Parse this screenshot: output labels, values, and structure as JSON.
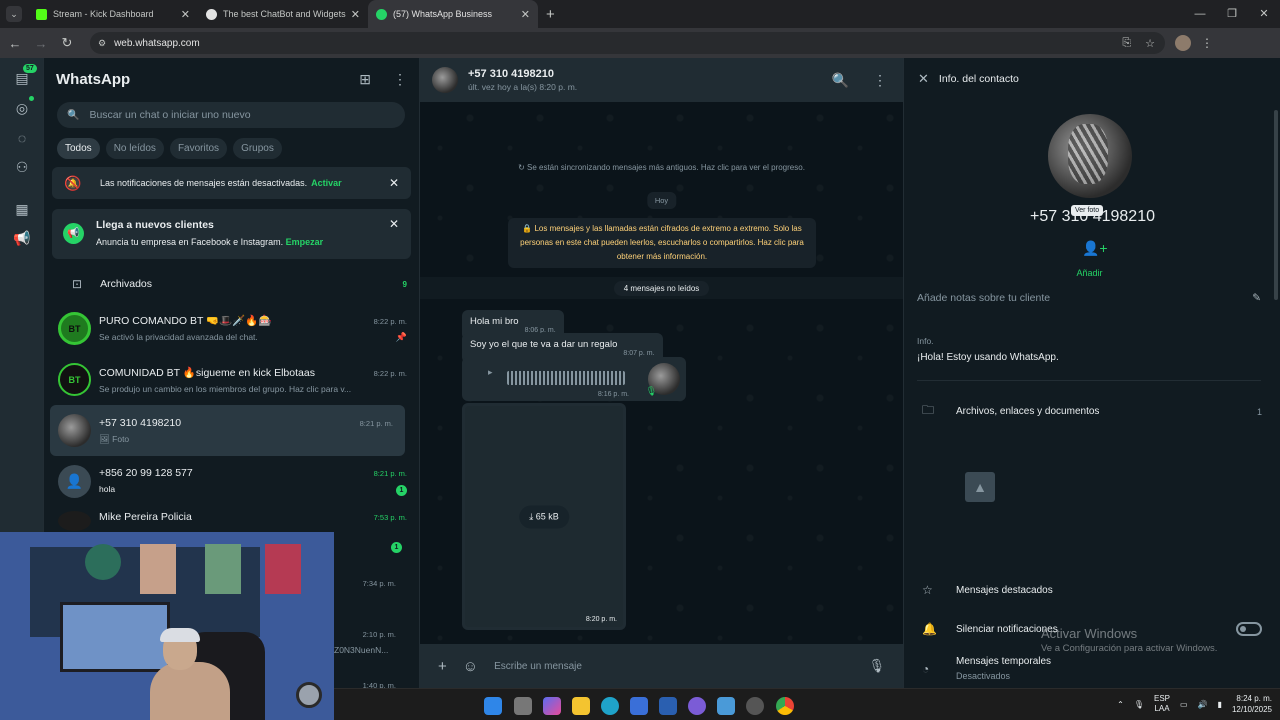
{
  "browser": {
    "tabs": [
      {
        "title": "Stream - Kick Dashboard",
        "favicon": "kick-icon",
        "color": "#53fc18"
      },
      {
        "title": "The best ChatBot and Widgets",
        "favicon": "botrix-icon",
        "color": "#e3e3e3"
      },
      {
        "title": "(57) WhatsApp Business",
        "favicon": "whatsapp-icon",
        "color": "#25d366"
      }
    ],
    "url": "web.whatsapp.com"
  },
  "rail": {
    "badge": "57"
  },
  "sidebar": {
    "title": "WhatsApp",
    "search_placeholder": "Buscar un chat o iniciar uno nuevo",
    "filters": [
      "Todos",
      "No leídos",
      "Favoritos",
      "Grupos"
    ],
    "notif_banner": {
      "text": "Las notificaciones de mensajes están desactivadas.",
      "action": "Activar"
    },
    "promo_banner": {
      "title": "Llega a nuevos clientes",
      "text": "Anuncia tu empresa en Facebook e Instagram.",
      "action": "Empezar"
    },
    "archived": {
      "label": "Archivados",
      "count": "9"
    },
    "chats": [
      {
        "name": "PURO COMANDO BT 🤜🎩🗡️🔥🎰",
        "time": "8:22 p. m.",
        "preview": "Se activó la privacidad avanzada del chat.",
        "avatar": "BT",
        "avatar_color": "#2e8b2e"
      },
      {
        "name": "COMUNIDAD BT 🔥sigueme en kick Elbotaas",
        "time": "8:22 p. m.",
        "preview": "Se produjo un cambio en los miembros del grupo. Haz clic para v...",
        "avatar": "BT",
        "avatar_color": "#111111"
      },
      {
        "name": "+57 310 4198210",
        "time": "8:21 p. m.",
        "preview": "Foto",
        "avatar": "",
        "avatar_color": "#4b4b4b"
      },
      {
        "name": "+856 20 99 128 577",
        "time": "8:21 p. m.",
        "preview": "hola",
        "avatar": "",
        "avatar_color": "#3b4a54",
        "unread": "1"
      },
      {
        "name": "Mike Pereira Policia",
        "time": "7:53 p. m.",
        "unread": "1"
      }
    ],
    "partial": [
      {
        "time": "7:34 p. m."
      },
      {
        "time": "2:10 p. m.",
        "preview": "Z0N3NuenN..."
      },
      {
        "time": "1:40 p. m."
      }
    ]
  },
  "conversation": {
    "contact": "+57 310 4198210",
    "last_seen": "últ. vez hoy a la(s) 8:20 p. m.",
    "sync_notice": "Se están sincronizando mensajes más antiguos. Haz clic para ver el progreso.",
    "date_pill": "Hoy",
    "encryption_notice": "Los mensajes y las llamadas están cifrados de extremo a extremo. Solo las personas en este chat pueden leerlos, escucharlos o compartirlos. Haz clic para obtener más información.",
    "unread_divider": "4 mensajes no leídos",
    "messages": [
      {
        "text": "Hola mi bro",
        "time": "8:06 p. m."
      },
      {
        "text": "Soy yo el que te va a dar un regalo",
        "time": "8:07 p. m."
      }
    ],
    "voice_time": "8:16 p. m.",
    "media_size": "65 kB",
    "media_time": "8:20 p. m.",
    "composer_placeholder": "Escribe un mensaje"
  },
  "contact_info": {
    "title": "Info. del contacto",
    "tooltip": "Ver foto",
    "phone": "+57 310 4198210",
    "add_label": "Añadir",
    "notes_placeholder": "Añade notas sobre tu cliente",
    "info_label": "Info.",
    "info_value": "¡Hola! Estoy usando WhatsApp.",
    "files_label": "Archivos, enlaces y documentos",
    "files_count": "1",
    "starred": "Mensajes destacados",
    "mute": "Silenciar notificaciones",
    "disappearing": "Mensajes temporales",
    "disappearing_state": "Desactivados"
  },
  "watermark": {
    "title": "Activar Windows",
    "subtitle": "Ve a Configuración para activar Windows."
  },
  "taskbar": {
    "lang1": "ESP",
    "lang2": "LAA",
    "time": "8:24 p. m.",
    "date": "12/10/2025"
  }
}
